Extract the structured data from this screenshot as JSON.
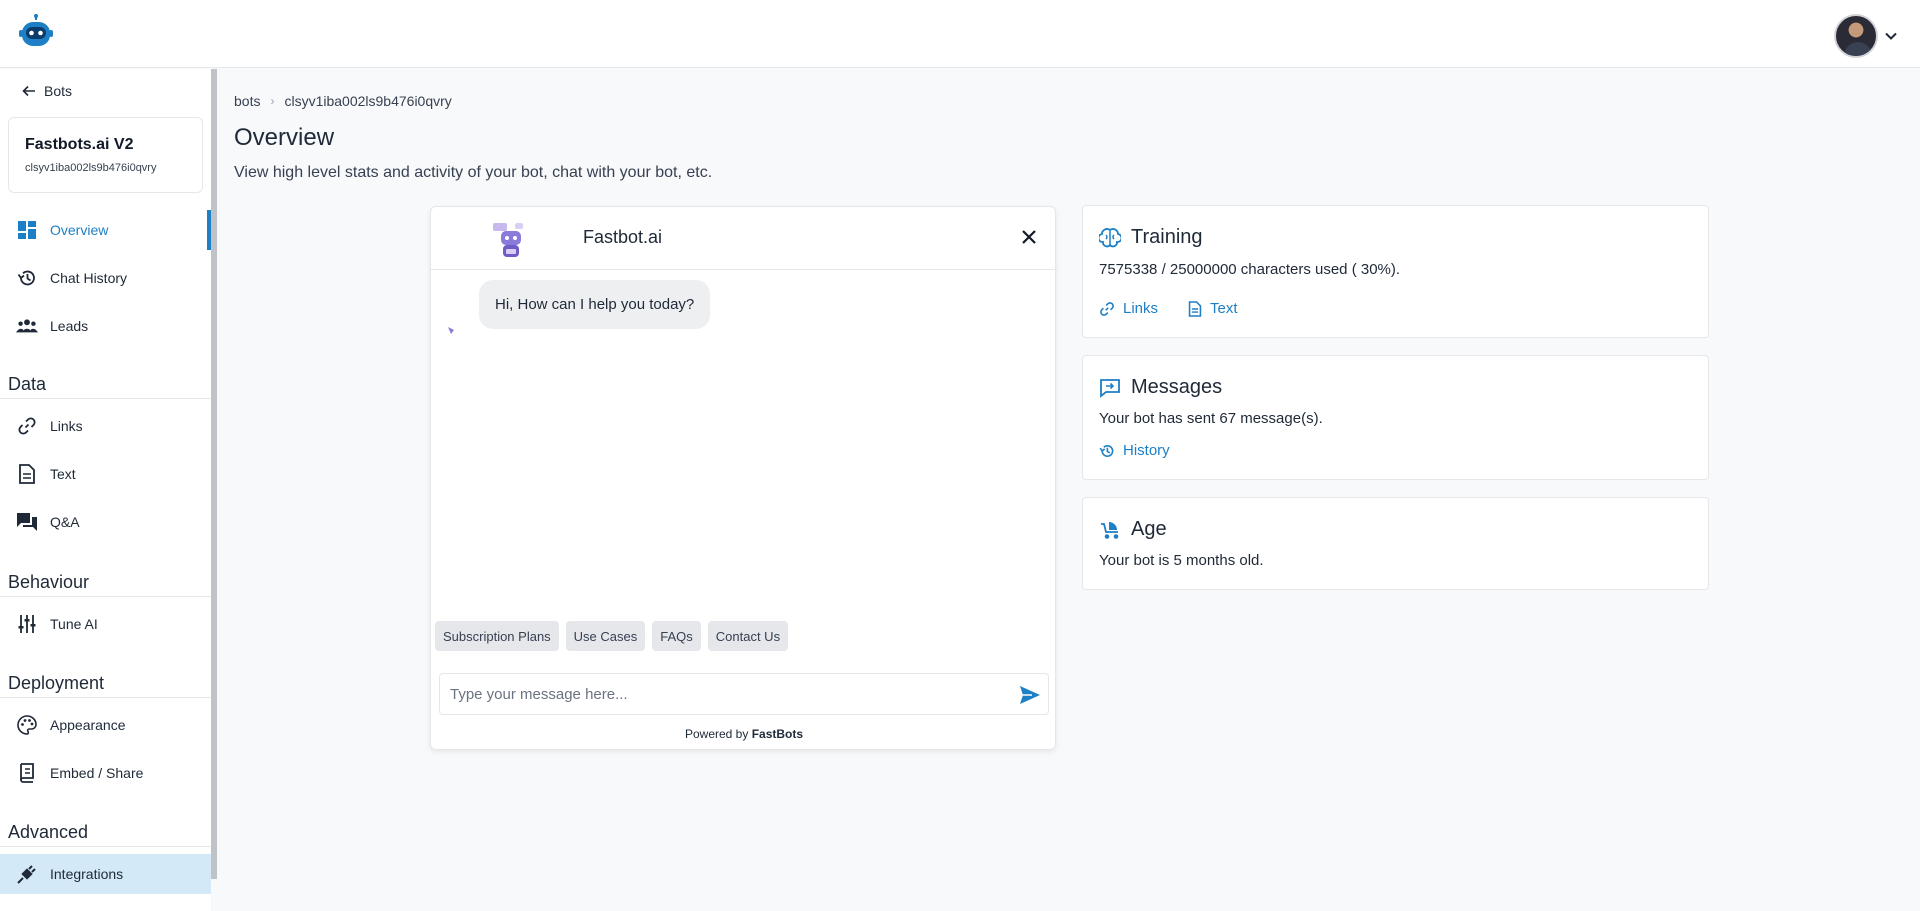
{
  "colors": {
    "accent": "#1d7fc5",
    "active_bg": "#d3e9f8",
    "page_bg": "#f8f9fb"
  },
  "sidebar": {
    "back_label": "Bots",
    "bot": {
      "name": "Fastbots.ai V2",
      "id": "clsyv1iba002ls9b476i0qvry"
    },
    "main_items": [
      {
        "label": "Overview",
        "icon": "dashboard-icon",
        "active": true
      },
      {
        "label": "Chat History",
        "icon": "history-icon"
      },
      {
        "label": "Leads",
        "icon": "people-icon"
      }
    ],
    "sections": {
      "data": {
        "title": "Data",
        "items": [
          {
            "label": "Links",
            "icon": "link-icon"
          },
          {
            "label": "Text",
            "icon": "document-icon"
          },
          {
            "label": "Q&A",
            "icon": "forum-icon"
          }
        ]
      },
      "behaviour": {
        "title": "Behaviour",
        "items": [
          {
            "label": "Tune AI",
            "icon": "sliders-icon"
          }
        ]
      },
      "deployment": {
        "title": "Deployment",
        "items": [
          {
            "label": "Appearance",
            "icon": "palette-icon"
          },
          {
            "label": "Embed / Share",
            "icon": "embed-icon"
          }
        ]
      },
      "advanced": {
        "title": "Advanced",
        "items": [
          {
            "label": "Integrations",
            "icon": "plug-icon",
            "highlight": true
          }
        ]
      }
    }
  },
  "breadcrumb": {
    "root": "bots",
    "current": "clsyv1iba002ls9b476i0qvry"
  },
  "page": {
    "title": "Overview",
    "subtitle": "View high level stats and activity of your bot, chat with your bot, etc."
  },
  "chat": {
    "title": "Fastbot.ai",
    "greeting": "Hi, How can I help you today?",
    "chips": [
      "Subscription Plans",
      "Use Cases",
      "FAQs",
      "Contact Us"
    ],
    "input_placeholder": "Type your message here...",
    "powered_prefix": "Powered by",
    "powered_brand": "FastBots"
  },
  "training": {
    "title": "Training",
    "usage": "7575338 / 25000000 characters used ( 30%).",
    "links_label": "Links",
    "text_label": "Text"
  },
  "messages": {
    "title": "Messages",
    "text": "Your bot has sent 67 message(s).",
    "history_label": "History"
  },
  "age": {
    "title": "Age",
    "text": "Your bot is 5 months old."
  }
}
